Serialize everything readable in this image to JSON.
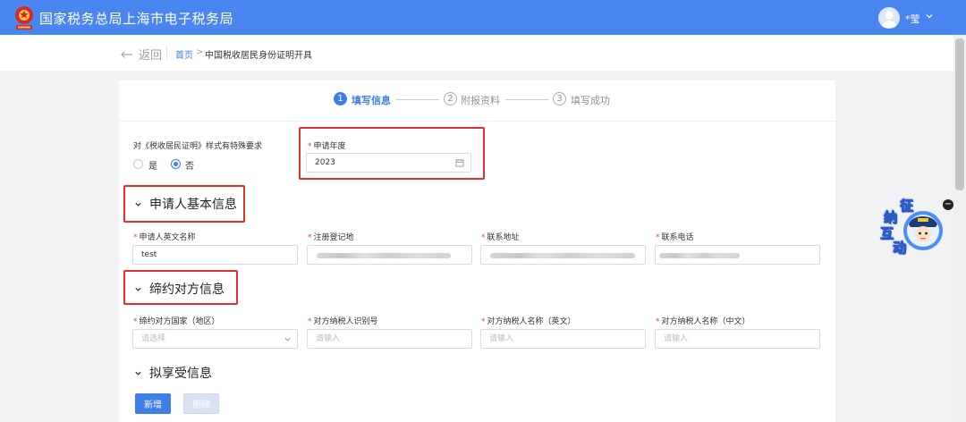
{
  "header": {
    "title": "国家税务总局上海市电子税务局",
    "user_name": "*莹",
    "brand_color": "#4a86f0"
  },
  "nav": {
    "back_label": "返回",
    "breadcrumb_home": "首页",
    "breadcrumb_separator": ">",
    "breadcrumb_current": "中国税收居民身份证明开具"
  },
  "steps": [
    {
      "number": "1",
      "label": "填写信息",
      "active": true
    },
    {
      "number": "2",
      "label": "附报资料",
      "active": false
    },
    {
      "number": "3",
      "label": "填写成功",
      "active": false
    }
  ],
  "form": {
    "special_style": {
      "label": "对《税收居民证明》样式有特殊要求",
      "options": [
        "是",
        "否"
      ],
      "selected": "否"
    },
    "apply_year": {
      "label": "申请年度",
      "value": "2023"
    }
  },
  "sections": {
    "applicant": {
      "title": "申请人基本信息",
      "fields": [
        {
          "label": "申请人英文名称",
          "value": "test"
        },
        {
          "label": "注册登记地",
          "value": ""
        },
        {
          "label": "联系地址",
          "value": ""
        },
        {
          "label": "联系电话",
          "value": ""
        }
      ]
    },
    "counterparty": {
      "title": "缔约对方信息",
      "fields": [
        {
          "label": "缔约对方国家（地区）",
          "placeholder": "请选择"
        },
        {
          "label": "对方纳税人识别号",
          "placeholder": "请输入"
        },
        {
          "label": "对方纳税人名称（英文）",
          "placeholder": "请输入"
        },
        {
          "label": "对方纳税人名称（中文）",
          "placeholder": "请输入"
        }
      ]
    },
    "benefit": {
      "title": "拟享受信息",
      "add_button": "新增",
      "delete_button": "删除"
    }
  },
  "widget": {
    "chars": [
      "征",
      "纳",
      "互",
      "动"
    ],
    "close_symbol": "−"
  }
}
